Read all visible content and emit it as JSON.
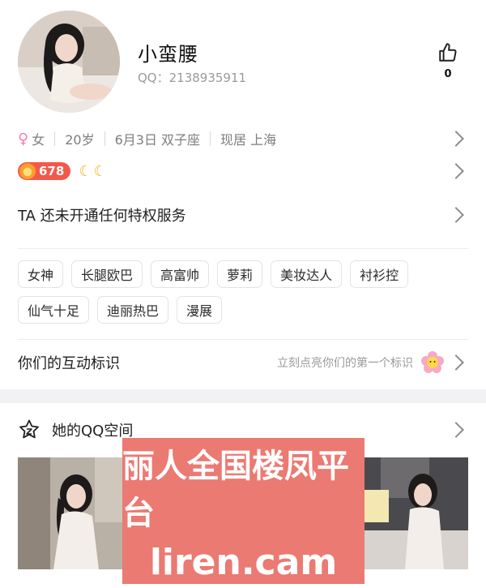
{
  "profile": {
    "name": "小蛮腰",
    "qq_label": "QQ：2138935911",
    "like_count": "0"
  },
  "info": {
    "gender": "女",
    "age": "20岁",
    "birthday": "6月3日 双子座",
    "location": "现居 上海"
  },
  "level": {
    "value": "678",
    "moons": [
      "moon-icon",
      "moon-icon"
    ]
  },
  "privilege": {
    "text": "TA 还未开通任何特权服务"
  },
  "tags": [
    "女神",
    "长腿欧巴",
    "高富帅",
    "萝莉",
    "美妆达人",
    "衬衫控",
    "仙气十足",
    "迪丽热巴",
    "漫展"
  ],
  "interaction": {
    "title": "你们的互动标识",
    "hint": "立刻点亮你们的第一个标识"
  },
  "space": {
    "title": "她的QQ空间"
  },
  "watermark": {
    "line1": "丽人全国楼凤平台",
    "line2": "liren.cam"
  },
  "colors": {
    "accent_badge": "#f4584a",
    "gender_pink": "#f27db0",
    "moon_gold": "#f3b21d",
    "watermark_bg": "#ea7a72"
  }
}
